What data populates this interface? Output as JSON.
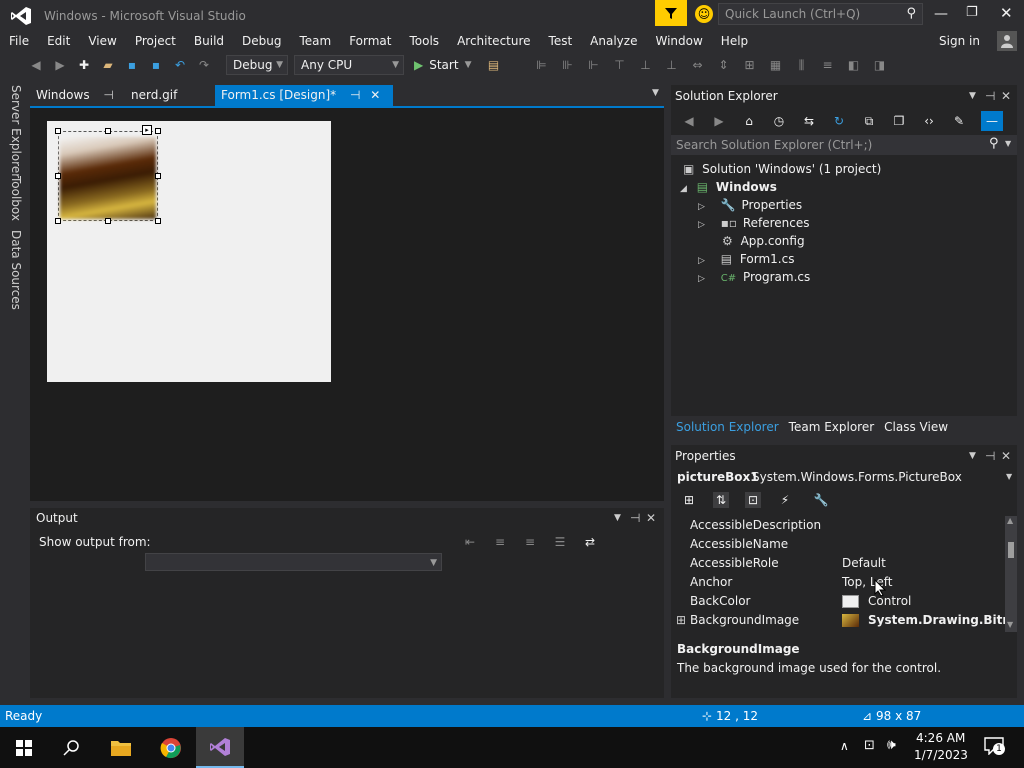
{
  "window": {
    "title": "Windows - Microsoft Visual Studio",
    "quick_launch_placeholder": "Quick Launch (Ctrl+Q)",
    "sign_in": "Sign in"
  },
  "menu": [
    "File",
    "Edit",
    "View",
    "Project",
    "Build",
    "Debug",
    "Team",
    "Format",
    "Tools",
    "Architecture",
    "Test",
    "Analyze",
    "Window",
    "Help"
  ],
  "toolbar": {
    "config": "Debug",
    "platform": "Any CPU",
    "start": "Start"
  },
  "left_tabs": [
    "Server Explorer",
    "Toolbox",
    "Data Sources"
  ],
  "doc_tabs": [
    {
      "label": "Windows"
    },
    {
      "label": "nerd.gif"
    },
    {
      "label": "Form1.cs [Design]*"
    }
  ],
  "output": {
    "title": "Output",
    "show_from": "Show output from:"
  },
  "solution_explorer": {
    "title": "Solution Explorer",
    "search_placeholder": "Search Solution Explorer (Ctrl+;)",
    "items": [
      "Solution 'Windows' (1 project)",
      "Windows",
      "Properties",
      "References",
      "App.config",
      "Form1.cs",
      "Program.cs"
    ],
    "bottom_tabs": [
      "Solution Explorer",
      "Team Explorer",
      "Class View"
    ]
  },
  "properties": {
    "title": "Properties",
    "object_name": "pictureBox1",
    "object_type": "System.Windows.Forms.PictureBox",
    "rows": [
      {
        "name": "AccessibleDescription",
        "value": ""
      },
      {
        "name": "AccessibleName",
        "value": ""
      },
      {
        "name": "AccessibleRole",
        "value": "Default"
      },
      {
        "name": "Anchor",
        "value": "Top, Left"
      },
      {
        "name": "BackColor",
        "value": "Control"
      },
      {
        "name": "BackgroundImage",
        "value": "System.Drawing.Bitmap"
      }
    ],
    "desc_title": "BackgroundImage",
    "desc_text": "The background image used for the control."
  },
  "status": {
    "text": "Ready",
    "position": "12 , 12",
    "size": "98 x 87"
  },
  "taskbar": {
    "time": "4:26 AM",
    "date": "1/7/2023",
    "notifications": "1"
  },
  "colors": {
    "accent": "#007acc",
    "bg": "#2d2d30",
    "panel": "#252526",
    "editor": "#1e1e1e",
    "vs_purple": "#68217a"
  }
}
